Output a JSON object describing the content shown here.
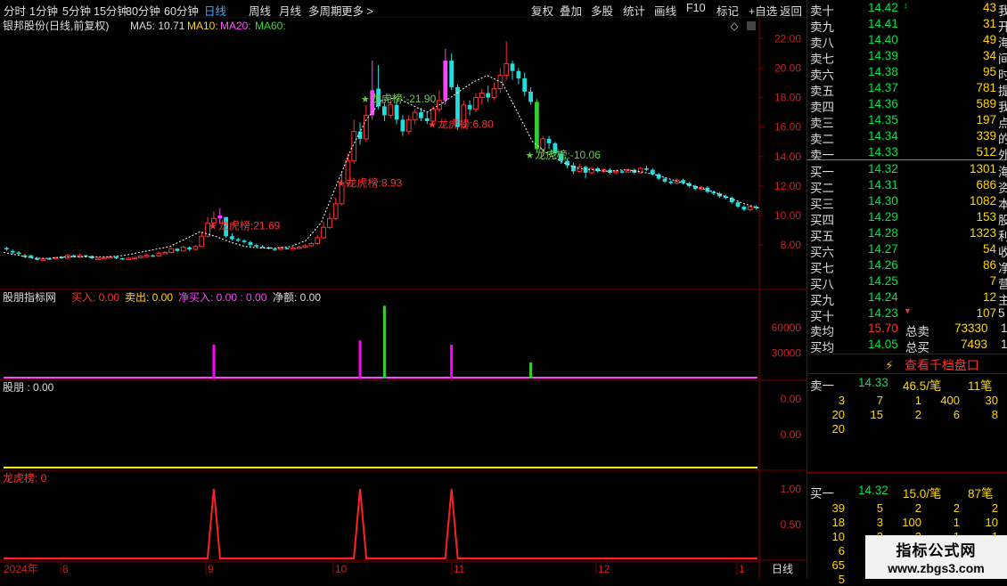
{
  "toolbar": {
    "periods": [
      "分时",
      "1分钟",
      "5分钟",
      "15分钟",
      "30分钟",
      "60分钟",
      "日线",
      "周线",
      "月线",
      "多周期",
      "更多 >"
    ],
    "active": "日线",
    "tools": [
      "复权",
      "叠加",
      "多股",
      "统计",
      "画线",
      "F10",
      "标记",
      "+自选",
      "返回"
    ]
  },
  "main": {
    "stock_label": "银邦股份(日线,前复权)",
    "ma5_label": "MA5: 10.71",
    "ma10_label": "MA10:",
    "ma20_label": "MA20:",
    "ma60_label": "MA60:",
    "y_ticks": [
      "22.00",
      "20.00",
      "18.00",
      "16.00",
      "14.00",
      "12.00",
      "10.00",
      "8.00"
    ],
    "annotations": [
      {
        "text": "龙虎榜:21.69",
        "color": "#ff3030"
      },
      {
        "text": "龙虎榜:8.93",
        "color": "#ff3030"
      },
      {
        "text": "龙虎榜:-21.90",
        "color": "#66cc44"
      },
      {
        "text": "龙虎榜:6.80",
        "color": "#ff3030"
      },
      {
        "text": "龙虎榜:-10.06",
        "color": "#66cc44"
      }
    ]
  },
  "panel1": {
    "title": "股朋指标网",
    "buy_label": "买入: 0.00",
    "sell_label": "卖出: 0.00",
    "net_buy_label": "净买入: 0.00 : 0.00",
    "net_amount_label": "净额: 0.00",
    "y_ticks": [
      "60000",
      "30000"
    ]
  },
  "panel2": {
    "title": "股朋 : 0.00",
    "y_ticks": [
      "0.00",
      "0.00"
    ]
  },
  "panel3": {
    "title": "龙虎榜: 0",
    "y_ticks": [
      "1.00",
      "0.50"
    ]
  },
  "x_axis": {
    "labels": [
      "2024年",
      "8",
      "9",
      "10",
      "11",
      "12",
      "1"
    ],
    "period_label": "日线"
  },
  "chart_data": {
    "type": "candlestick",
    "y_range": [
      6.5,
      22.8
    ],
    "candles": [
      [
        7.8,
        7.7,
        7.9,
        7.6
      ],
      [
        7.6,
        7.5,
        7.7,
        7.4
      ],
      [
        7.5,
        7.4,
        7.6,
        7.3
      ],
      [
        7.3,
        7.2,
        7.4,
        7.1
      ],
      [
        7.3,
        7.15,
        7.35,
        7.1
      ],
      [
        7.1,
        7.0,
        7.2,
        6.95
      ],
      [
        7.0,
        7.05,
        7.1,
        6.95
      ],
      [
        7.1,
        7.05,
        7.15,
        7.0
      ],
      [
        7.1,
        7.15,
        7.2,
        7.05
      ],
      [
        7.2,
        7.1,
        7.25,
        7.05
      ],
      [
        7.1,
        7.3,
        7.4,
        7.05
      ],
      [
        7.3,
        7.2,
        7.35,
        7.15
      ],
      [
        7.2,
        7.3,
        7.4,
        7.15
      ],
      [
        7.3,
        7.25,
        7.35,
        7.2
      ],
      [
        7.25,
        7.1,
        7.3,
        7.05
      ],
      [
        7.1,
        7.1,
        7.2,
        7.0
      ],
      [
        7.1,
        7.15,
        7.2,
        7.05
      ],
      [
        7.15,
        7.2,
        7.3,
        7.1
      ],
      [
        7.2,
        7.1,
        7.25,
        7.05
      ],
      [
        7.1,
        7.05,
        7.15,
        7.0
      ],
      [
        7.05,
        7.1,
        7.2,
        7.0
      ],
      [
        7.1,
        7.15,
        7.2,
        7.05
      ],
      [
        7.15,
        7.25,
        7.3,
        7.1
      ],
      [
        7.25,
        7.3,
        7.4,
        7.2
      ],
      [
        7.3,
        7.25,
        7.35,
        7.2
      ],
      [
        7.25,
        7.45,
        7.55,
        7.2
      ],
      [
        7.45,
        7.5,
        7.6,
        7.4
      ],
      [
        7.5,
        7.75,
        7.85,
        7.45
      ],
      [
        7.75,
        7.6,
        7.8,
        7.55
      ],
      [
        7.6,
        7.85,
        7.95,
        7.55
      ],
      [
        7.85,
        7.7,
        7.9,
        7.6
      ],
      [
        7.7,
        7.9,
        8.0,
        7.65
      ],
      [
        7.9,
        8.6,
        8.9,
        7.85
      ],
      [
        8.6,
        9.5,
        9.9,
        8.5
      ],
      [
        9.5,
        9.8,
        10.3,
        9.3
      ],
      [
        9.8,
        10.0,
        10.5,
        9.5
      ],
      [
        9.9,
        8.6,
        9.5,
        8.5
      ],
      [
        8.6,
        8.4,
        8.8,
        8.3
      ],
      [
        8.4,
        8.3,
        8.5,
        8.2
      ],
      [
        8.3,
        8.2,
        8.4,
        8.1
      ],
      [
        8.2,
        8.0,
        8.3,
        7.9
      ],
      [
        8.0,
        7.9,
        8.1,
        7.8
      ],
      [
        7.9,
        7.85,
        8.0,
        7.8
      ],
      [
        7.85,
        7.75,
        7.9,
        7.7
      ],
      [
        7.75,
        7.7,
        7.8,
        7.6
      ],
      [
        7.7,
        7.8,
        7.9,
        7.65
      ],
      [
        7.8,
        7.75,
        7.85,
        7.7
      ],
      [
        7.75,
        7.8,
        7.9,
        7.7
      ],
      [
        7.8,
        7.85,
        7.95,
        7.75
      ],
      [
        7.85,
        7.95,
        8.05,
        7.8
      ],
      [
        7.95,
        8.1,
        8.2,
        7.9
      ],
      [
        8.1,
        8.5,
        8.7,
        8.0
      ],
      [
        8.5,
        9.2,
        9.6,
        8.4
      ],
      [
        9.2,
        9.8,
        10.2,
        9.1
      ],
      [
        9.8,
        10.8,
        11.2,
        9.7
      ],
      [
        10.8,
        12.2,
        13.0,
        10.7
      ],
      [
        12.2,
        13.7,
        14.2,
        12.0
      ],
      [
        13.7,
        15.7,
        16.5,
        13.5
      ],
      [
        15.7,
        15.2,
        16.3,
        14.8
      ],
      [
        15.2,
        16.8,
        17.5,
        15.0
      ],
      [
        16.8,
        18.5,
        20.5,
        16.5
      ],
      [
        18.6,
        17.4,
        20.2,
        17.2
      ],
      [
        17.4,
        16.8,
        17.7,
        16.4
      ],
      [
        16.8,
        17.5,
        18.0,
        16.6
      ],
      [
        17.5,
        16.5,
        17.9,
        16.2
      ],
      [
        16.5,
        15.7,
        16.8,
        15.4
      ],
      [
        15.7,
        16.5,
        16.8,
        15.5
      ],
      [
        16.5,
        17.0,
        17.2,
        16.2
      ],
      [
        17.0,
        16.6,
        17.3,
        16.4
      ],
      [
        16.6,
        16.4,
        17.0,
        16.2
      ],
      [
        16.4,
        17.2,
        17.4,
        16.3
      ],
      [
        17.2,
        17.8,
        18.5,
        17.0
      ],
      [
        17.8,
        20.5,
        21.3,
        17.5
      ],
      [
        20.5,
        18.7,
        21.0,
        18.5
      ],
      [
        18.7,
        16.0,
        18.9,
        15.8
      ],
      [
        16.0,
        17.5,
        17.8,
        15.9
      ],
      [
        17.5,
        17.2,
        17.8,
        16.8
      ],
      [
        17.2,
        18.0,
        18.3,
        17.0
      ],
      [
        18.0,
        18.3,
        18.6,
        17.5
      ],
      [
        18.3,
        18.0,
        18.8,
        17.7
      ],
      [
        18.0,
        18.6,
        19.0,
        17.8
      ],
      [
        18.6,
        19.5,
        20.0,
        18.3
      ],
      [
        19.5,
        20.3,
        21.8,
        19.2
      ],
      [
        20.3,
        19.8,
        20.5,
        19.2
      ],
      [
        19.8,
        19.3,
        20.0,
        18.9
      ],
      [
        19.3,
        18.4,
        19.7,
        18.1
      ],
      [
        18.4,
        17.7,
        18.7,
        17.5
      ],
      [
        17.7,
        14.5,
        17.9,
        14.3
      ],
      [
        14.5,
        15.2,
        15.4,
        14.0
      ],
      [
        15.2,
        14.9,
        15.4,
        14.5
      ],
      [
        14.9,
        14.2,
        15.0,
        14.0
      ],
      [
        14.2,
        13.7,
        14.4,
        13.5
      ],
      [
        13.7,
        13.4,
        13.9,
        13.2
      ],
      [
        13.4,
        13.0,
        13.6,
        12.8
      ],
      [
        13.0,
        13.3,
        13.5,
        12.9
      ],
      [
        13.3,
        12.9,
        13.4,
        12.5
      ],
      [
        12.9,
        13.2,
        13.3,
        12.8
      ],
      [
        13.2,
        13.0,
        13.3,
        12.9
      ],
      [
        13.0,
        13.1,
        13.2,
        12.9
      ],
      [
        13.1,
        12.9,
        13.2,
        12.8
      ],
      [
        12.9,
        13.0,
        13.1,
        12.8
      ],
      [
        13.0,
        12.95,
        13.1,
        12.85
      ],
      [
        12.95,
        13.1,
        13.2,
        12.9
      ],
      [
        13.1,
        12.9,
        13.2,
        12.8
      ],
      [
        12.9,
        13.2,
        13.3,
        12.85
      ],
      [
        13.2,
        13.1,
        13.4,
        13.0
      ],
      [
        13.1,
        12.8,
        13.2,
        12.7
      ],
      [
        12.8,
        12.5,
        12.9,
        12.4
      ],
      [
        12.5,
        12.3,
        12.6,
        12.2
      ],
      [
        12.3,
        12.2,
        12.4,
        12.1
      ],
      [
        12.2,
        12.4,
        12.5,
        12.1
      ],
      [
        12.4,
        12.2,
        12.5,
        12.1
      ],
      [
        12.2,
        12.0,
        12.3,
        11.9
      ],
      [
        12.0,
        11.8,
        12.1,
        11.7
      ],
      [
        11.8,
        11.9,
        12.0,
        11.7
      ],
      [
        11.9,
        11.6,
        12.0,
        11.5
      ],
      [
        11.6,
        11.5,
        11.7,
        11.4
      ],
      [
        11.5,
        11.3,
        11.6,
        11.2
      ],
      [
        11.3,
        11.2,
        11.4,
        11.1
      ],
      [
        11.2,
        10.9,
        11.3,
        10.8
      ],
      [
        10.9,
        10.6,
        11.0,
        10.5
      ],
      [
        10.6,
        10.4,
        10.7,
        10.3
      ],
      [
        10.4,
        10.6,
        10.7,
        10.3
      ],
      [
        10.6,
        10.5,
        10.7,
        10.4
      ]
    ],
    "trend_line": [
      7.5,
      7.3,
      7.1,
      7.1,
      7.2,
      7.2,
      7.2,
      7.2,
      7.3,
      7.5,
      7.7,
      7.9,
      8.4,
      8.9,
      8.6,
      8.2,
      7.9,
      7.8,
      7.8,
      7.9,
      8.3,
      9.5,
      12.0,
      14.5,
      16.5,
      17.8,
      18.0,
      17.5,
      17.0,
      17.6,
      18.3,
      19.0,
      19.5,
      19.0,
      17.0,
      15.0,
      14.2,
      13.6,
      13.2,
      13.1,
      13.0,
      13.1,
      13.0,
      12.8,
      12.5,
      12.2,
      11.9,
      11.6,
      11.2,
      10.8,
      10.5
    ],
    "lhb_series": [
      {
        "type": "bar",
        "name": "买入",
        "values": [
          40000,
          45000,
          86000,
          40000,
          19000
        ],
        "colors": [
          "#ff00ff",
          "#ff00ff",
          "#33cc33",
          "#ff00ff",
          "#33cc33"
        ]
      }
    ],
    "lhb_signal": {
      "type": "line",
      "values": [
        1,
        1,
        1
      ]
    }
  },
  "orderbook": {
    "asks": [
      {
        "label": "卖十",
        "price": "14.42",
        "arrow": "↕",
        "vol": "43",
        "cut": "我"
      },
      {
        "label": "卖九",
        "price": "14.41",
        "vol": "31",
        "cut": "开"
      },
      {
        "label": "卖八",
        "price": "14.40",
        "vol": "49",
        "cut": "海"
      },
      {
        "label": "卖七",
        "price": "14.39",
        "vol": "34",
        "cut": "间"
      },
      {
        "label": "卖六",
        "price": "14.38",
        "vol": "95",
        "cut": "时"
      },
      {
        "label": "卖五",
        "price": "14.37",
        "vol": "781",
        "cut": "提"
      },
      {
        "label": "卖四",
        "price": "14.36",
        "vol": "589",
        "cut": "我"
      },
      {
        "label": "卖三",
        "price": "14.35",
        "vol": "197",
        "cut": "点"
      },
      {
        "label": "卖二",
        "price": "14.34",
        "vol": "339",
        "cut": "的"
      },
      {
        "label": "卖一",
        "price": "14.33",
        "vol": "512",
        "cut": "外"
      }
    ],
    "bids": [
      {
        "label": "买一",
        "price": "14.32",
        "vol": "1301",
        "cut": "海"
      },
      {
        "label": "买二",
        "price": "14.31",
        "vol": "686",
        "cut": "资"
      },
      {
        "label": "买三",
        "price": "14.30",
        "vol": "1082",
        "cut": "本"
      },
      {
        "label": "买四",
        "price": "14.29",
        "vol": "153",
        "cut": "股"
      },
      {
        "label": "买五",
        "price": "14.28",
        "vol": "1323",
        "cut": "利"
      },
      {
        "label": "买六",
        "price": "14.27",
        "vol": "54",
        "cut": "收"
      },
      {
        "label": "买七",
        "price": "14.26",
        "vol": "86",
        "cut": "净"
      },
      {
        "label": "买八",
        "price": "14.25",
        "vol": "7",
        "cut": "营"
      },
      {
        "label": "买九",
        "price": "14.24",
        "vol": "12",
        "cut": "主"
      },
      {
        "label": "买十",
        "price": "14.23",
        "arrow": "▼",
        "vol": "107",
        "cut": "5"
      }
    ],
    "avg_sell_label": "卖均",
    "avg_sell": "15.70",
    "total_sell_label": "总卖",
    "total_sell": "73330",
    "cut_s": "1",
    "avg_buy_label": "买均",
    "avg_buy": "14.05",
    "total_buy_label": "总买",
    "total_buy": "7493",
    "cut_b": "1",
    "qiandang_label": "查看千档盘口",
    "sell1": {
      "label": "卖一",
      "price": "14.33",
      "avg": "46.5/笔",
      "count": "11笔"
    },
    "sell1_queue": [
      [
        "3",
        "7",
        "1",
        "400",
        "30"
      ],
      [
        "20",
        "15",
        "2",
        "6",
        "8"
      ],
      [
        "20",
        "",
        "",
        "",
        ""
      ]
    ],
    "buy1": {
      "label": "买一",
      "price": "14.32",
      "avg": "15.0/笔",
      "count": "87笔"
    },
    "buy1_queue": [
      [
        "39",
        "5",
        "2",
        "2",
        "2"
      ],
      [
        "18",
        "3",
        "100",
        "1",
        "10"
      ],
      [
        "10",
        "2",
        "3",
        "1",
        "1"
      ],
      [
        "6",
        "",
        "",
        "",
        ""
      ],
      [
        "65",
        "",
        "",
        "",
        ""
      ],
      [
        "5",
        "",
        "",
        "",
        ""
      ]
    ]
  },
  "watermark": {
    "line1": "指标公式网",
    "line2": "www.zbgs3.com"
  }
}
